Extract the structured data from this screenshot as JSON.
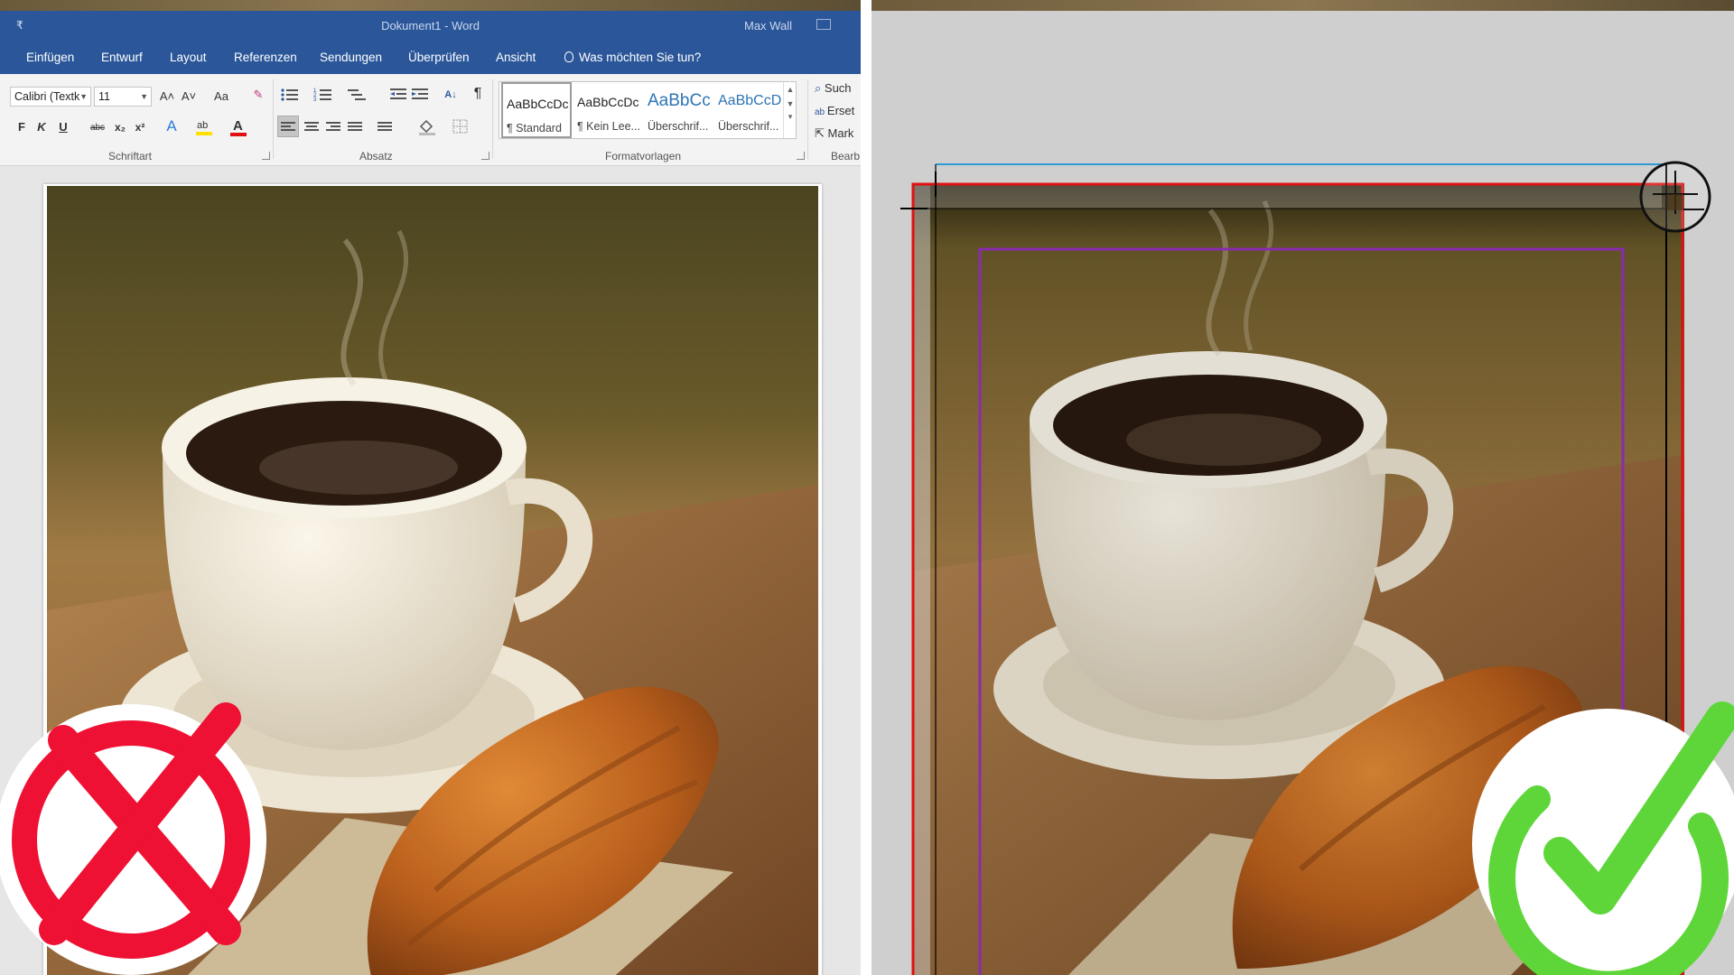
{
  "word": {
    "qat_symbol": "₹",
    "title": "Dokument1  -  Word",
    "user": "Max Wall",
    "tabs": [
      "Einfügen",
      "Entwurf",
      "Layout",
      "Referenzen",
      "Sendungen",
      "Überprüfen",
      "Ansicht"
    ],
    "tell_me": "Was möchten Sie tun?",
    "font_name": "Calibri (Textk",
    "font_size": "11",
    "grow_font": "A˄",
    "shrink_font": "A˅",
    "change_case": "Aa",
    "bold": "F",
    "italic": "K",
    "underline": "U",
    "strikethrough": "abc",
    "subscript": "x₂",
    "superscript": "x²",
    "pilcrow": "¶",
    "group_font": "Schriftart",
    "group_paragraph": "Absatz",
    "group_styles": "Formatvorlagen",
    "group_editing": "Bearb",
    "styles": [
      {
        "sample": "AaBbCcDc",
        "name": "¶ Standard",
        "kind": "normal"
      },
      {
        "sample": "AaBbCcDc",
        "name": "¶ Kein Lee...",
        "kind": "normal"
      },
      {
        "sample": "AaBbCc",
        "name": "Überschrif...",
        "kind": "heading"
      },
      {
        "sample": "AaBbCcD",
        "name": "Überschrif...",
        "kind": "heading2"
      }
    ],
    "editing": {
      "find": "Such",
      "replace": "Erset",
      "select": "Mark"
    }
  },
  "badges": {
    "wrong_color": "#ee1133",
    "right_color": "#5ed63a"
  },
  "colors": {
    "word_blue": "#2b579a",
    "bleed_line": "#e01010",
    "margin_line": "#8a2bb0",
    "crop_line": "#2f9ad6"
  }
}
